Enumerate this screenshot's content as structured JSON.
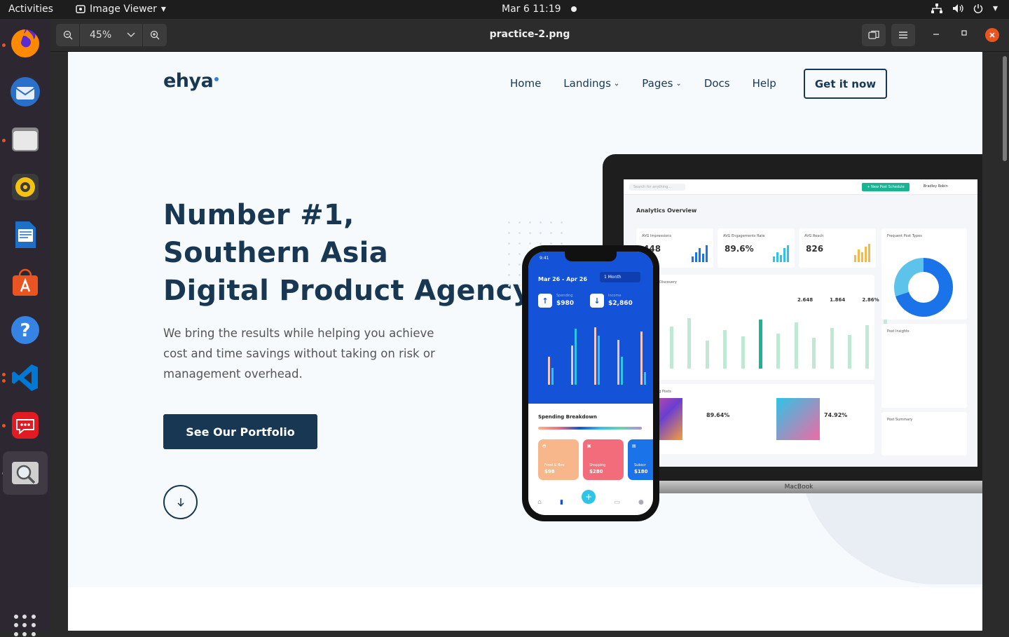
{
  "topbar": {
    "activities": "Activities",
    "app_name": "Image Viewer",
    "clock": "Mar 6  11:19"
  },
  "dock": {
    "items": [
      {
        "name": "firefox-icon",
        "color": "#e66000"
      },
      {
        "name": "thunderbird-icon",
        "color": "#2a6fc9"
      },
      {
        "name": "files-icon",
        "color": "#d7d7d7"
      },
      {
        "name": "rhythmbox-icon",
        "color": "#f5c211"
      },
      {
        "name": "writer-icon",
        "color": "#1e6fc8"
      },
      {
        "name": "software-center-icon",
        "color": "#e95420"
      },
      {
        "name": "help-icon",
        "color": "#3584e4"
      },
      {
        "name": "vscode-icon",
        "color": "#0078d4"
      },
      {
        "name": "chat-icon",
        "color": "#e01b24"
      },
      {
        "name": "image-viewer-icon",
        "color": "#bdbdbd"
      }
    ]
  },
  "viewer": {
    "zoom": "45%",
    "file_name": "practice-2.png"
  },
  "site": {
    "logo": "ehya",
    "nav": [
      "Home",
      "Landings",
      "Pages",
      "Docs",
      "Help"
    ],
    "cta": "Get it now",
    "headline": [
      "Number #1,",
      "Southern Asia",
      "Digital Product Agency"
    ],
    "subtext": "We bring the results while helping you achieve cost and time savings without taking on risk or management overhead.",
    "portfolio_button": "See Our Portfolio",
    "brand_color": "#173753"
  },
  "laptop": {
    "brand": "MacBook",
    "search_placeholder": "Search for anything...",
    "new_post_button": "+ New Post Schedule",
    "user": "Bradley Robin",
    "title": "Analytics Overview",
    "cards": [
      {
        "label": "AVG Impressions",
        "value": "448"
      },
      {
        "label": "AVG Engagements Rate",
        "value": "89.6%"
      },
      {
        "label": "AVG Reach",
        "value": "826"
      }
    ],
    "frequent_post_types": "Frequent Post Types",
    "growth_title": "Growth & Discovery",
    "growth_stats": [
      "2.648",
      "1.864",
      "2.86%"
    ],
    "post_insights": "Post Insights",
    "performing_posts": "Performing Posts",
    "engagement_values": [
      "89.64%",
      "74.92%"
    ],
    "post_summary": "Post Summary"
  },
  "phone": {
    "time": "9:41",
    "range": "Mar 26 - Apr 26",
    "period": "1 Month",
    "spending_label": "Spending",
    "spending": "$980",
    "income_label": "Income",
    "income": "$2,860",
    "breakdown_title": "Spending Breakdown",
    "categories": [
      {
        "name": "Food & Bev",
        "amount": "$98",
        "color": "#f7b78a"
      },
      {
        "name": "Shopping",
        "amount": "$280",
        "color": "#f36c7c"
      },
      {
        "name": "Subscr",
        "amount": "$180",
        "color": "#1a73e8"
      }
    ]
  }
}
